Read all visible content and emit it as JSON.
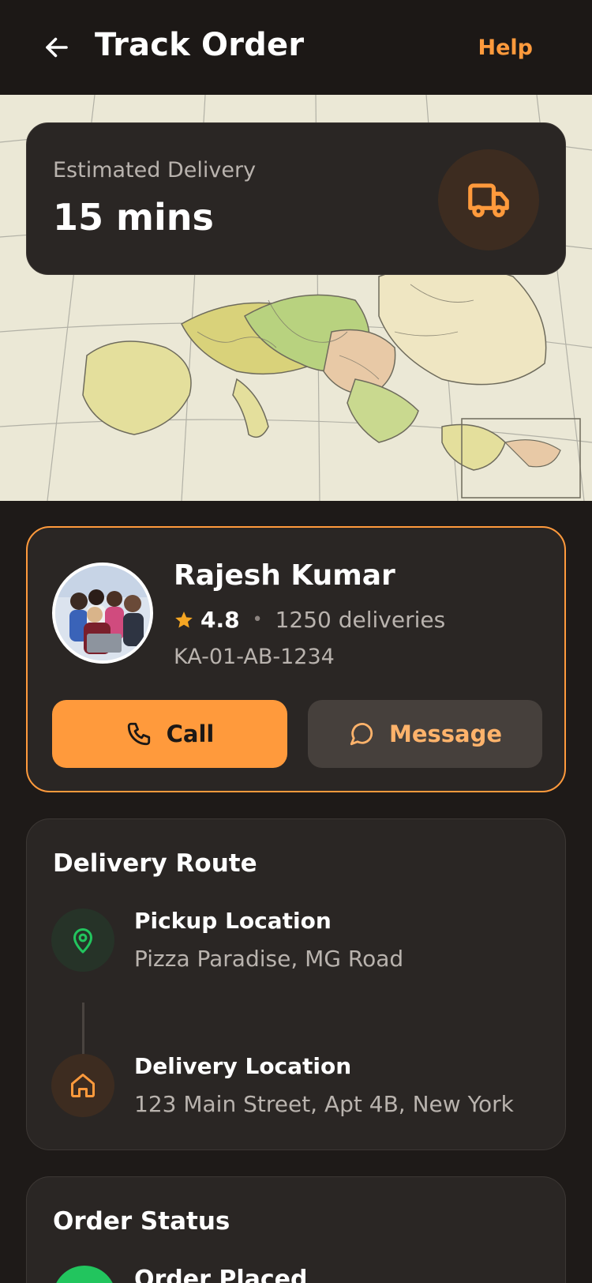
{
  "header": {
    "title": "Track Order",
    "help_label": "Help"
  },
  "eta": {
    "label": "Estimated Delivery",
    "value": "15 mins"
  },
  "driver": {
    "name": "Rajesh Kumar",
    "rating": "4.8",
    "separator": "•",
    "deliveries": "1250 deliveries",
    "plate": "KA-01-AB-1234",
    "call_label": "Call",
    "message_label": "Message"
  },
  "route": {
    "title": "Delivery Route",
    "pickup": {
      "title": "Pickup Location",
      "address": "Pizza Paradise, MG Road"
    },
    "dropoff": {
      "title": "Delivery Location",
      "address": "123 Main Street, Apt 4B, New York"
    }
  },
  "status": {
    "title": "Order Status",
    "items": [
      {
        "label": "Order Placed"
      }
    ]
  },
  "colors": {
    "accent": "#ff9a3c",
    "background": "#1e1a18",
    "card": "#2a2624",
    "success": "#22c55e"
  },
  "icons": {
    "back": "arrow-left-icon",
    "truck": "truck-icon",
    "star": "star-icon",
    "phone": "phone-icon",
    "message": "chat-bubble-icon",
    "pin": "map-pin-icon",
    "home": "home-icon"
  }
}
